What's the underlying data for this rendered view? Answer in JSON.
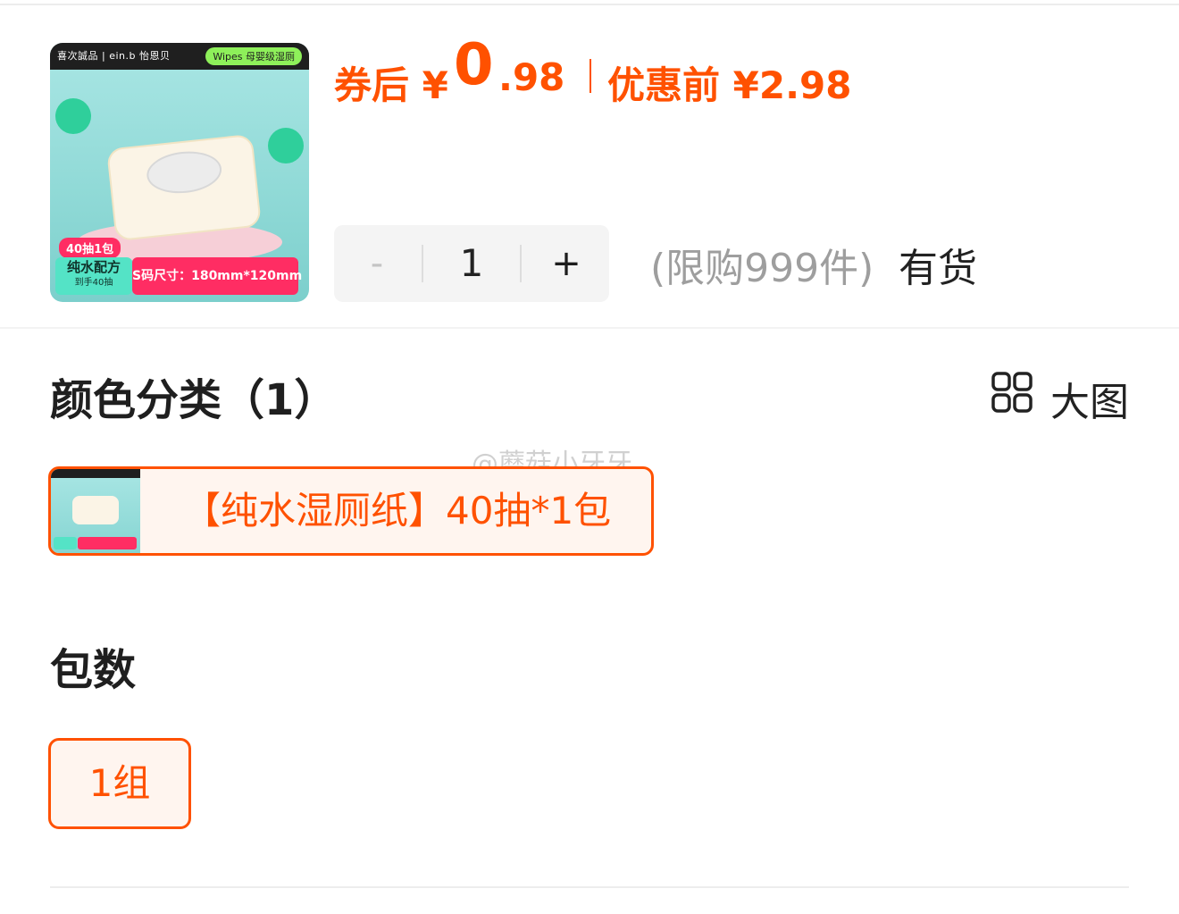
{
  "product": {
    "image": {
      "brand_text": "喜次誠品 | ein.b 怡恩贝",
      "tag_text": "Wipes 母婴级湿厕",
      "count_badge": "40抽1包",
      "pure_line1": "纯水配方",
      "pure_line2": "到手40抽",
      "size_text": "S码尺寸：180mm*120mm"
    }
  },
  "price": {
    "after_coupon_label": "券后 ¥",
    "after_coupon_int": "0",
    "after_coupon_dec": ".98",
    "before_label": "优惠前 ¥2.98",
    "accent_color": "#ff5100"
  },
  "quantity": {
    "minus": "-",
    "value": "1",
    "plus": "+",
    "limit_text": "(限购999件)",
    "stock_text": "有货"
  },
  "color_section": {
    "title": "颜色分类（1）",
    "view_toggle_label": "大图",
    "view_toggle_icon": "grid-icon",
    "options": [
      {
        "label": "【纯水湿厕纸】40抽*1包",
        "selected": true
      }
    ]
  },
  "pack_section": {
    "title": "包数",
    "options": [
      {
        "label": "1组",
        "selected": true
      }
    ]
  },
  "watermark": "@蘑菇小牙牙"
}
